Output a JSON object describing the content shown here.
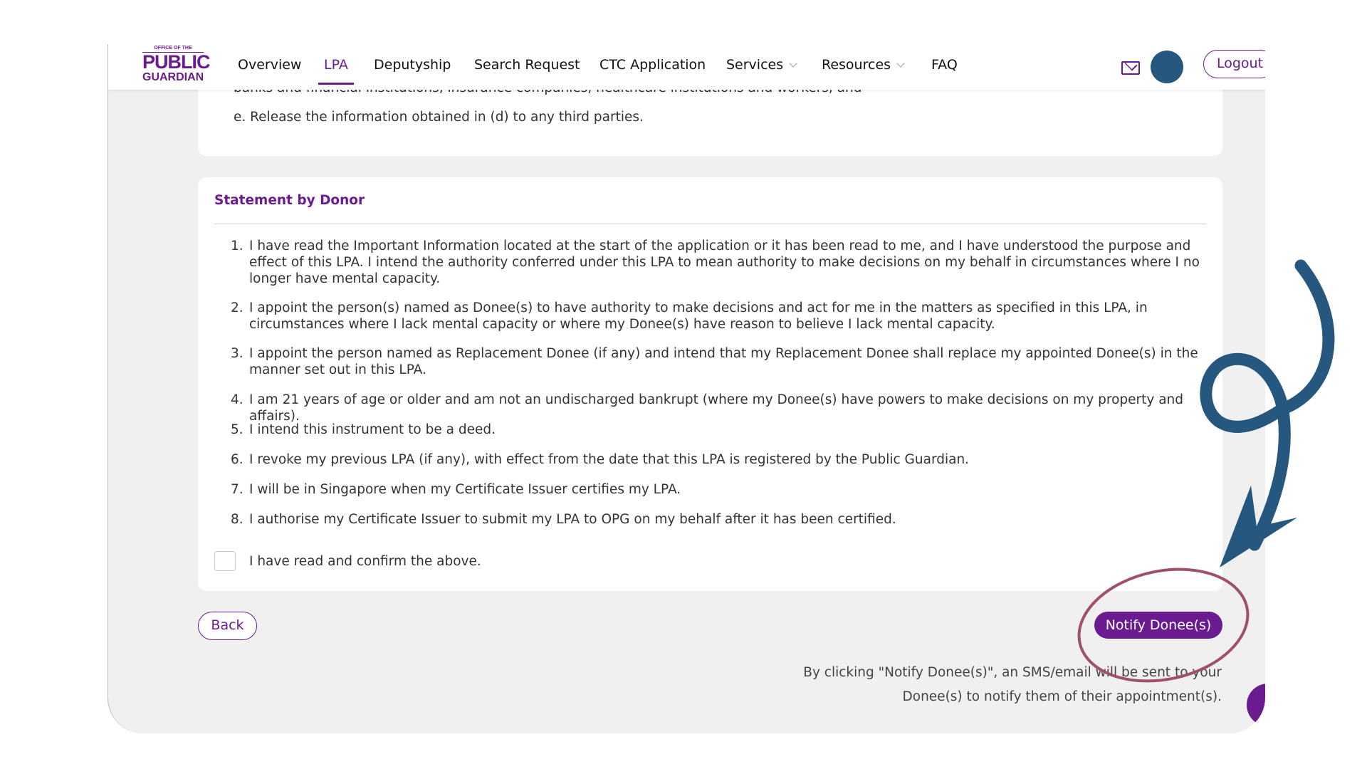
{
  "header": {
    "logo": {
      "small": "OFFICE OF THE",
      "big": "PUBLIC",
      "mid": "GUARDIAN"
    },
    "nav": [
      {
        "label": "Overview"
      },
      {
        "label": "LPA",
        "active": true
      },
      {
        "label": "Deputyship"
      },
      {
        "label": "Search Request"
      },
      {
        "label": "CTC Application"
      },
      {
        "label": "Services",
        "dropdown": true
      },
      {
        "label": "Resources",
        "dropdown": true
      },
      {
        "label": "FAQ"
      }
    ],
    "logout": "Logout",
    "icons": [
      "mail-icon",
      "avatar"
    ]
  },
  "card1": {
    "partial_line": "banks and financial institutions, insurance companies, healthcare institutions and workers, and",
    "item_e": "e. Release the information obtained in (d) to any third parties."
  },
  "statement": {
    "title": "Statement by Donor",
    "items": [
      "I have read the Important Information located at the start of the application or it has been read to me, and I have understood the purpose and effect of this LPA. I intend the authority conferred under this LPA to mean authority to make decisions on my behalf in circumstances where I no longer have mental capacity.",
      "I appoint the person(s) named as Donee(s) to have authority to make decisions and act for me in the matters as specified in this LPA, in circumstances where I lack mental capacity or where my Donee(s) have reason to believe I lack mental capacity.",
      "I appoint the person named as Replacement Donee (if any) and intend that my Replacement Donee shall replace my appointed Donee(s) in the manner set out in this LPA.",
      "I am 21 years of age or older and am not an undischarged bankrupt (where my Donee(s) have powers to make decisions on my property and affairs).",
      "I intend this instrument to be a deed.",
      "I revoke my previous LPA (if any), with effect from the date that this LPA is registered by the Public Guardian.",
      "I will be in Singapore when my Certificate Issuer certifies my LPA.",
      "I authorise my Certificate Issuer to submit my LPA to OPG on my behalf after it has been certified."
    ],
    "numbers": [
      "1.",
      "2.",
      "3.",
      "4.",
      "5.",
      "6.",
      "7.",
      "8."
    ],
    "confirm_label": "I have read and confirm the above.",
    "confirm_checked": false
  },
  "actions": {
    "back": "Back",
    "notify": "Notify Donee(s)",
    "note_line1": "By clicking \"Notify Donee(s)\", an SMS/email will be sent to your",
    "note_line2": "Donee(s) to notify them of their appointment(s)."
  },
  "colors": {
    "brand": "#6a1b8f",
    "avatar": "#25577f",
    "arrow_annotation": "#25577f",
    "circle_annotation": "#a0506a"
  }
}
